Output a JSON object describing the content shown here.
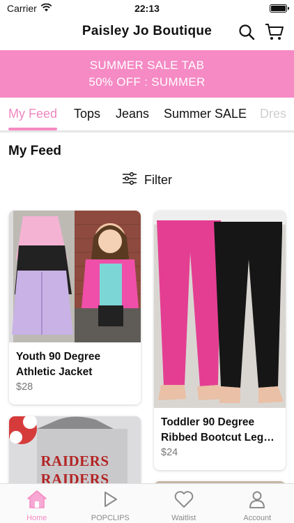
{
  "status_bar": {
    "carrier": "Carrier",
    "time": "22:13",
    "icons": [
      "wifi-icon",
      "battery-icon"
    ]
  },
  "header": {
    "title": "Paisley Jo Boutique",
    "icons": [
      "search-icon",
      "cart-icon"
    ]
  },
  "promo": {
    "line1": "SUMMER SALE TAB",
    "line2": "50% OFF : SUMMER",
    "bg_color": "#f58ac4"
  },
  "tabs": [
    {
      "label": "My Feed",
      "active": true
    },
    {
      "label": "Tops"
    },
    {
      "label": "Jeans"
    },
    {
      "label": "Summer SALE"
    },
    {
      "label": "Dres"
    }
  ],
  "section": {
    "title": "My Feed",
    "filter_label": "Filter"
  },
  "products": [
    {
      "name": "Youth 90 Degree Athletic Jacket",
      "price": "$28"
    },
    {
      "name": "Toddler 90 Degree Ribbed Bootcut Leg…",
      "price": "$24"
    }
  ],
  "partial_card": {
    "text_line1": "RAIDERS",
    "text_line2": "RAIDERS"
  },
  "tab_bar": [
    {
      "label": "Home",
      "icon": "home-icon",
      "active": true
    },
    {
      "label": "POPCLIPS",
      "icon": "play-icon"
    },
    {
      "label": "Waitlist",
      "icon": "heart-icon"
    },
    {
      "label": "Account",
      "icon": "person-icon"
    }
  ],
  "colors": {
    "accent": "#f58ac4",
    "active_tab_text": "#ef86c0"
  }
}
